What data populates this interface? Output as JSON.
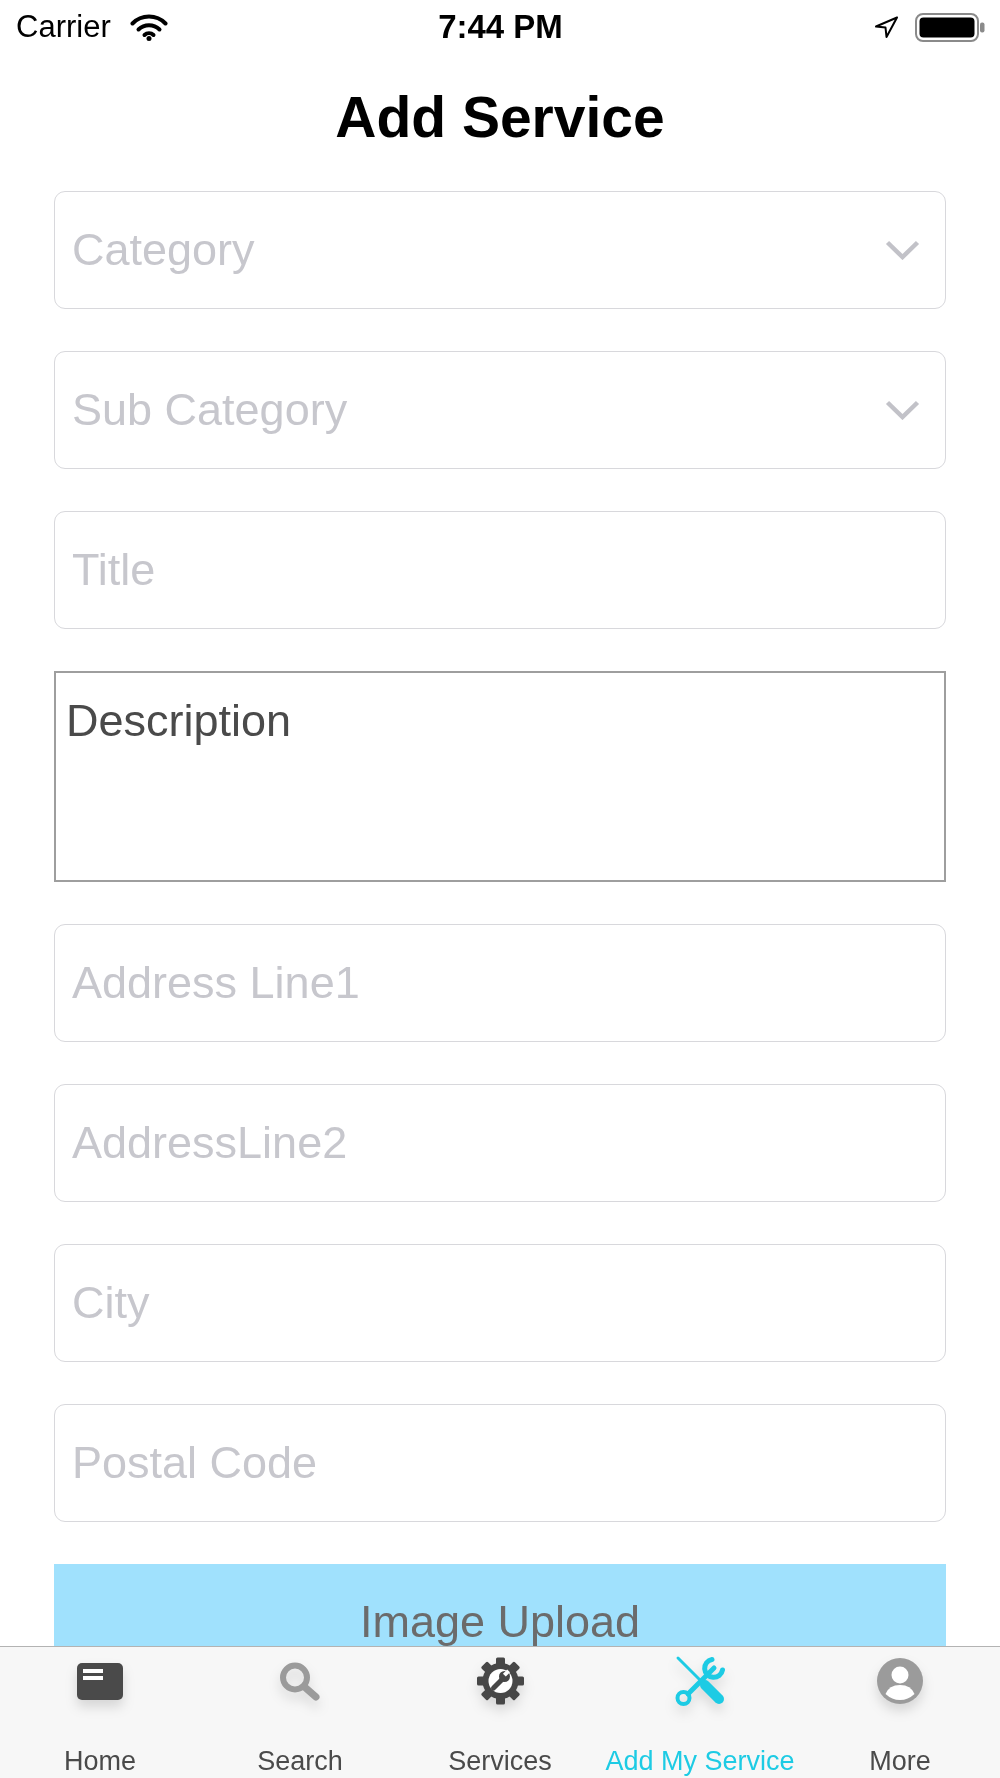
{
  "status_bar": {
    "carrier": "Carrier",
    "time": "7:44 PM"
  },
  "header": {
    "title": "Add Service"
  },
  "form": {
    "fields": [
      {
        "kind": "dropdown",
        "placeholder": "Category"
      },
      {
        "kind": "dropdown",
        "placeholder": "Sub Category"
      },
      {
        "kind": "text",
        "placeholder": "Title"
      },
      {
        "kind": "textarea",
        "value": "Description"
      },
      {
        "kind": "text",
        "placeholder": "Address Line1"
      },
      {
        "kind": "text",
        "placeholder": "AddressLine2"
      },
      {
        "kind": "text",
        "placeholder": "City"
      },
      {
        "kind": "text",
        "placeholder": "Postal Code"
      }
    ],
    "upload_button": {
      "label": "Image Upload"
    }
  },
  "tab_bar": {
    "tabs": [
      {
        "label": "Home",
        "selected": false
      },
      {
        "label": "Search",
        "selected": false
      },
      {
        "label": "Services",
        "selected": false
      },
      {
        "label": "Add My Service",
        "selected": true
      },
      {
        "label": "More",
        "selected": false
      }
    ]
  }
}
